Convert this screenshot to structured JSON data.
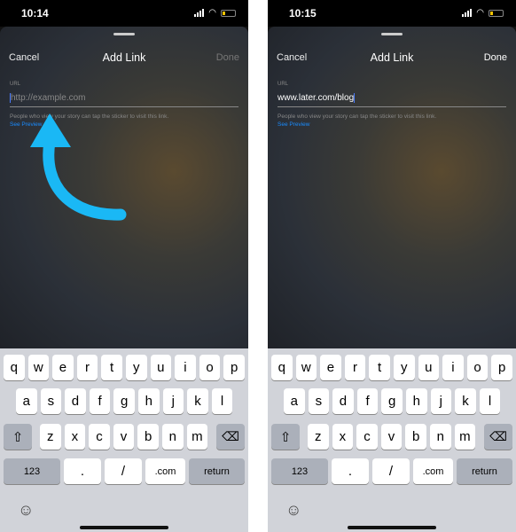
{
  "screens": [
    {
      "time": "10:14",
      "cancel": "Cancel",
      "title": "Add Link",
      "done": "Done",
      "done_enabled": false,
      "url_label": "URL",
      "url_value": "",
      "url_placeholder": "http://example.com",
      "hint": "People who view your story can tap the sticker to visit this link.",
      "preview": "See Preview"
    },
    {
      "time": "10:15",
      "cancel": "Cancel",
      "title": "Add Link",
      "done": "Done",
      "done_enabled": true,
      "url_label": "URL",
      "url_value": "www.later.com/blog",
      "url_placeholder": "http://example.com",
      "hint": "People who view your story can tap the sticker to visit this link.",
      "preview": "See Preview"
    }
  ],
  "keyboard": {
    "row1": [
      "q",
      "w",
      "e",
      "r",
      "t",
      "y",
      "u",
      "i",
      "o",
      "p"
    ],
    "row2": [
      "a",
      "s",
      "d",
      "f",
      "g",
      "h",
      "j",
      "k",
      "l"
    ],
    "row3": [
      "z",
      "x",
      "c",
      "v",
      "b",
      "n",
      "m"
    ],
    "numbers": "123",
    "period": ".",
    "slash": "/",
    "dotcom": ".com",
    "return": "return"
  },
  "annotation": {
    "arrow_color": "#1ab8f5",
    "icon": "curved-arrow-up-icon"
  },
  "colors": {
    "accent": "#1a8cff"
  }
}
